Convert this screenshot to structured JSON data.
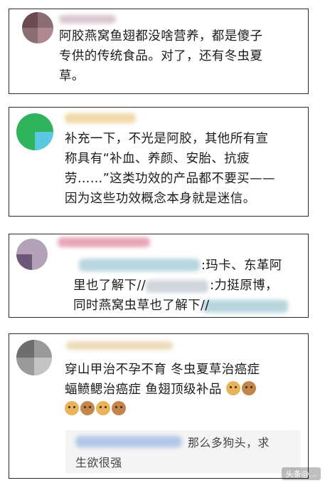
{
  "comments": [
    {
      "lines": [
        "阿胶燕窝鱼翅都没啥营养，都是傻子",
        "专供的传统食品。对了，还有冬虫夏",
        "草。"
      ]
    },
    {
      "lines": [
        "补充一下，不光是阿胶，其他所有宣",
        "称具有“补血、养颜、安胎、抗疲",
        "劳……”这类功效的产品都不要买——",
        "因为这些功效概念本身就是迷信。"
      ]
    },
    {
      "lines": [
        ":玛卡、东革阿",
        "里也了解下//",
        ":力挺原博，",
        "同时燕窝虫草也了解下//"
      ]
    },
    {
      "lines": [
        "穿山甲治不孕不育 冬虫夏草治癌症",
        "蝠鲼鳃治癌症 鱼翅顶级补品"
      ],
      "reply": "那么多狗头，求",
      "reply2": "生欲很强"
    }
  ],
  "colors": {
    "border": "#2a2a2a",
    "text": "#1b1b1b",
    "green": "#2fb35a"
  },
  "emoji": [
    "doge-icon",
    "dog-face-icon"
  ],
  "watermark": "头条@..."
}
